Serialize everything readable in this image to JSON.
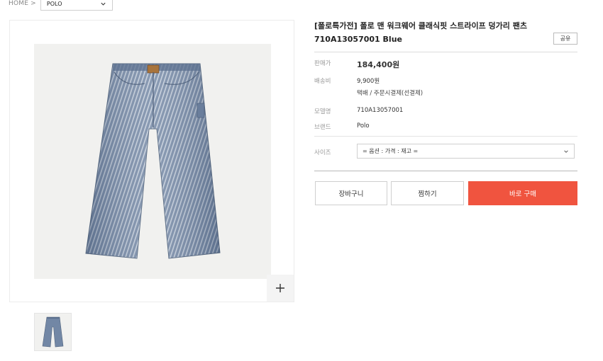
{
  "breadcrumb": {
    "home": "HOME >",
    "category": "POLO"
  },
  "product": {
    "title": "[폴로특가전] 폴로 맨 워크웨어 클래식핏 스트라이프 덩가리 팬츠 710A13057001 Blue",
    "share_label": "공유",
    "price_label": "판매가",
    "price": "184,400원",
    "shipping_label": "배송비",
    "shipping_fee": "9,900원",
    "shipping_method": "택배  / 주문시결제(선결제)",
    "model_label": "모델명",
    "model": "710A13057001",
    "brand_label": "브랜드",
    "brand": "Polo",
    "size_label": "사이즈",
    "size_select": "= 옵션 : 가격 : 재고 ="
  },
  "buttons": {
    "cart": "장바구니",
    "wish": "찜하기",
    "buy": "바로 구매"
  },
  "colors": {
    "buy_button": "#f0543f",
    "denim": "#6f83a0"
  }
}
